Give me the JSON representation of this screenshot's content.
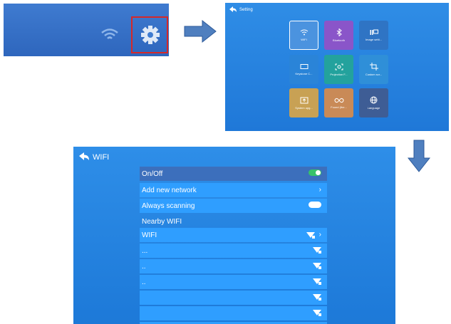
{
  "settings": {
    "title": "Setting",
    "tiles": [
      {
        "label": "WIFI",
        "icon": "wifi-icon",
        "color": "#4b93df"
      },
      {
        "label": "Bluetooth",
        "icon": "bluetooth-icon",
        "color": "#8a55c9"
      },
      {
        "label": "Image setti...",
        "icon": "image-setting-icon",
        "color": "#2f74c4"
      },
      {
        "label": "Keystone C...",
        "icon": "keystone-icon",
        "color": "#2a84d8"
      },
      {
        "label": "Projection F...",
        "icon": "projection-icon",
        "color": "#23a29d"
      },
      {
        "label": "Custom scr...",
        "icon": "crop-icon",
        "color": "#2f8fd8"
      },
      {
        "label": "System upg...",
        "icon": "system-upgrade-icon",
        "color": "#c8a154"
      },
      {
        "label": "Found (the...",
        "icon": "infinity-icon",
        "color": "#c98a57"
      },
      {
        "label": "Language",
        "icon": "globe-icon",
        "color": "#3e5d95"
      }
    ]
  },
  "wifi": {
    "title": "WIFI",
    "rows": [
      {
        "label": "On/Off",
        "control": "toggle-on"
      },
      {
        "label": "Add new network",
        "control": "chevron"
      },
      {
        "label": "Always scanning",
        "control": "toggle-off"
      },
      {
        "label": "Nearby WIFI",
        "control": "none"
      },
      {
        "label": "WIFI",
        "control": "wifi-lock-chevron"
      },
      {
        "label": "...",
        "control": "wifi-lock"
      },
      {
        "label": "..",
        "control": "wifi-lock"
      },
      {
        "label": "..",
        "control": "wifi-lock"
      },
      {
        "label": "",
        "control": "wifi-lock"
      },
      {
        "label": "",
        "control": "wifi-lock"
      },
      {
        "label": "",
        "control": "wifi-lock"
      }
    ]
  }
}
